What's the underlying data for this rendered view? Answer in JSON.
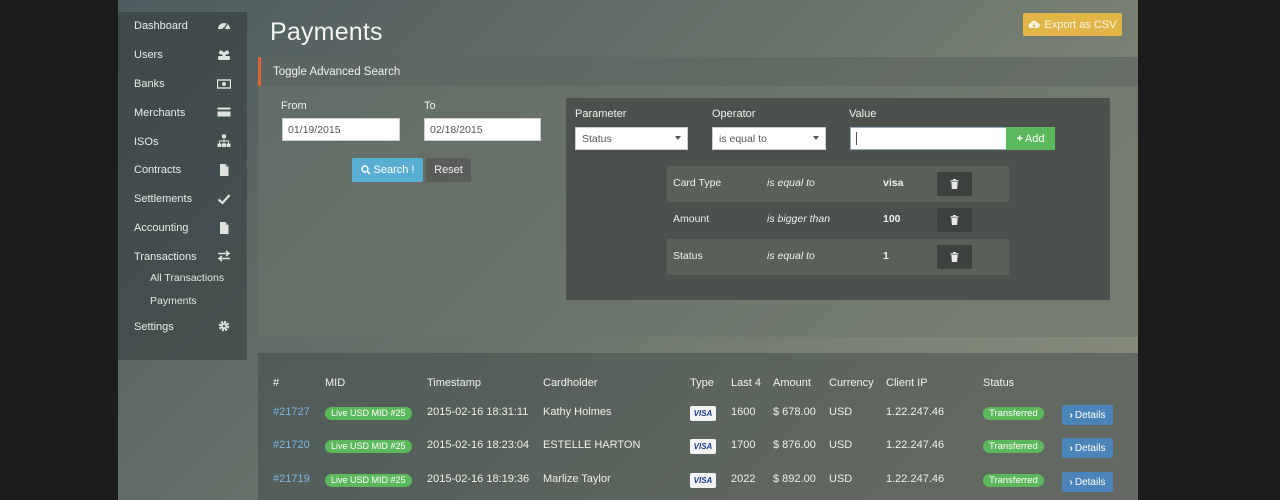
{
  "sidebar": {
    "items": [
      {
        "label": "Dashboard",
        "icon": "dashboard-icon"
      },
      {
        "label": "Users",
        "icon": "users-icon"
      },
      {
        "label": "Banks",
        "icon": "money-icon"
      },
      {
        "label": "Merchants",
        "icon": "credit-card-icon"
      },
      {
        "label": "ISOs",
        "icon": "sitemap-icon"
      },
      {
        "label": "Contracts",
        "icon": "file-icon"
      },
      {
        "label": "Settlements",
        "icon": "check-icon"
      },
      {
        "label": "Accounting",
        "icon": "file-icon"
      },
      {
        "label": "Transactions",
        "icon": "exchange-icon"
      }
    ],
    "sub_items": [
      "All Transactions",
      "Payments"
    ],
    "settings": {
      "label": "Settings",
      "icon": "gear-icon"
    }
  },
  "header": {
    "title": "Payments",
    "export_label": "Export as CSV"
  },
  "search": {
    "toggle_label": "Toggle Advanced Search",
    "from_label": "From",
    "from_value": "01/19/2015",
    "to_label": "To",
    "to_value": "02/18/2015",
    "search_label": "Search !",
    "reset_label": "Reset"
  },
  "advanced": {
    "parameter_label": "Parameter",
    "parameter_value": "Status",
    "operator_label": "Operator",
    "operator_value": "is equal to",
    "value_label": "Value",
    "value_value": "",
    "add_label": "Add",
    "criteria": [
      {
        "field": "Card Type",
        "operator": "is equal to",
        "value": "visa"
      },
      {
        "field": "Amount",
        "operator": "is bigger than",
        "value": "100"
      },
      {
        "field": "Status",
        "operator": "is equal to",
        "value": "1"
      }
    ]
  },
  "table": {
    "headers": [
      "#",
      "MID",
      "Timestamp",
      "Cardholder",
      "Type",
      "Last 4",
      "Amount",
      "Currency",
      "Client IP",
      "Status"
    ],
    "details_label": "Details",
    "rows": [
      {
        "id": "#21727",
        "mid": "Live USD MID #25",
        "timestamp": "2015-02-16 18:31:11",
        "cardholder": "Kathy Holmes",
        "type": "VISA",
        "last4": "1600",
        "amount": "$ 678.00",
        "currency": "USD",
        "ip": "1.22.247.46",
        "status": "Transferred"
      },
      {
        "id": "#21720",
        "mid": "Live USD MID #25",
        "timestamp": "2015-02-16 18:23:04",
        "cardholder": "ESTELLE HARTON",
        "type": "VISA",
        "last4": "1700",
        "amount": "$ 876.00",
        "currency": "USD",
        "ip": "1.22.247.46",
        "status": "Transferred"
      },
      {
        "id": "#21719",
        "mid": "Live USD MID #25",
        "timestamp": "2015-02-16 18:19:36",
        "cardholder": "Marlize Taylor",
        "type": "VISA",
        "last4": "2022",
        "amount": "$ 892.00",
        "currency": "USD",
        "ip": "1.22.247.46",
        "status": "Transferred"
      }
    ]
  },
  "colors": {
    "accent_orange": "#e0643a",
    "export_yellow": "#e2b548",
    "search_blue": "#5aaed3",
    "success_green": "#5cb85c",
    "link_blue": "#7cb5e2",
    "details_blue": "#4a84b8"
  }
}
